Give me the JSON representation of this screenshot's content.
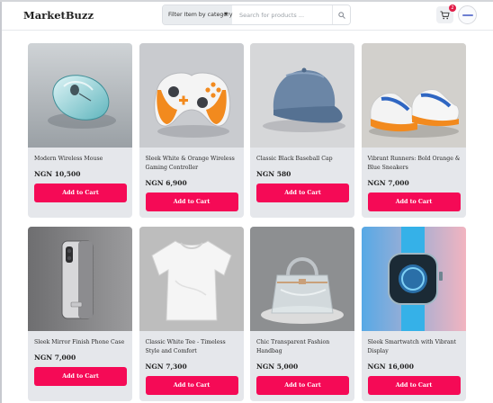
{
  "app": {
    "brand": "MarketBuzz"
  },
  "header": {
    "filter_label": "Filter Item by category",
    "search_placeholder": "Search for products ...",
    "cart_count": "2"
  },
  "colors": {
    "accent": "#f50a56",
    "card_bg": "#e5e7eb",
    "badge": "#e11d48"
  },
  "icons": {
    "search": "search-icon",
    "cart": "cart-icon",
    "caret": "chevron-down-icon"
  },
  "products": [
    {
      "title": "Modern Wireless Mouse",
      "price": "NGN 10,500",
      "button": "Add to Cart"
    },
    {
      "title": "Sleek White & Orange Wireless Gaming Controller",
      "price": "NGN 6,900",
      "button": "Add to Cart"
    },
    {
      "title": "Classic Black Baseball Cap",
      "price": "NGN 580",
      "button": "Add to Cart"
    },
    {
      "title": "Vibrant Runners: Bold Orange & Blue Sneakers",
      "price": "NGN 7,000",
      "button": "Add to Cart"
    },
    {
      "title": "Sleek Mirror Finish Phone Case",
      "price": "NGN 7,000",
      "button": "Add to Cart"
    },
    {
      "title": "Classic White Tee - Timeless Style and Comfort",
      "price": "NGN 7,300",
      "button": "Add to Cart"
    },
    {
      "title": "Chic Transparent Fashion Handbag",
      "price": "NGN 5,000",
      "button": "Add to Cart"
    },
    {
      "title": "Sleek Smartwatch with Vibrant Display",
      "price": "NGN 16,000",
      "button": "Add to Cart"
    }
  ]
}
